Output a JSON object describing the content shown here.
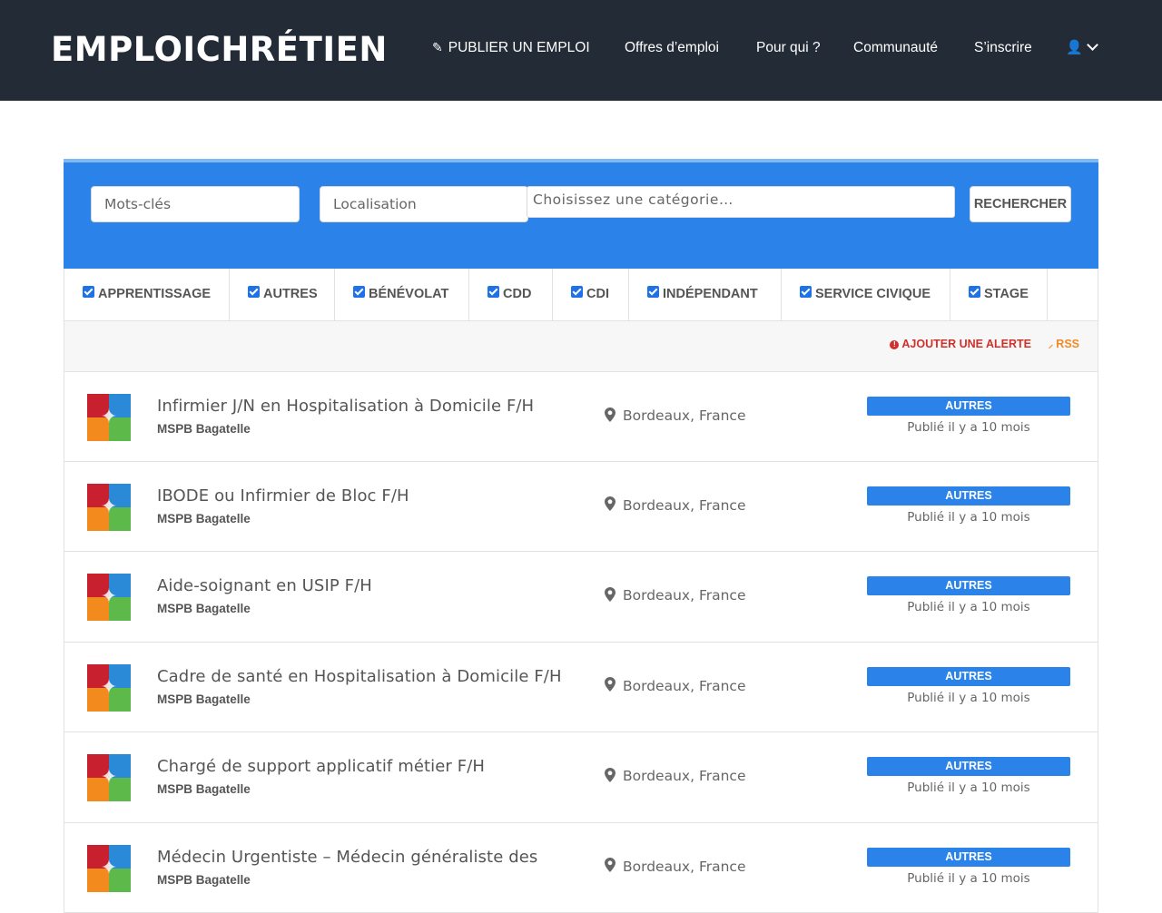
{
  "header": {
    "brand": "EMPLOICHRÉTIEN",
    "nav": {
      "publish": "PUBLIER UN EMPLOI",
      "offres": "Offres d’emploi",
      "pour_qui": "Pour qui ?",
      "communaute": "Communauté",
      "inscrire": "S’inscrire"
    }
  },
  "search": {
    "keywords_placeholder": "Mots-clés",
    "location_placeholder": "Localisation",
    "category_placeholder": "Choisissez une catégorie…",
    "button": "RECHERCHER"
  },
  "job_types": [
    "APPRENTISSAGE",
    "AUTRES",
    "BÉNÉVOLAT",
    "CDD",
    "CDI",
    "INDÉPENDANT",
    "SERVICE CIVIQUE",
    "STAGE"
  ],
  "actions": {
    "alert": "AJOUTER UNE ALERTE",
    "rss": "RSS"
  },
  "jobs": [
    {
      "title": "Infirmier J/N en Hospitalisation à Domicile F/H",
      "company": "MSPB Bagatelle",
      "location": "Bordeaux, France",
      "type": "AUTRES",
      "date": "Publié il y a 10 mois"
    },
    {
      "title": "IBODE ou Infirmier de Bloc F/H",
      "company": "MSPB Bagatelle",
      "location": "Bordeaux, France",
      "type": "AUTRES",
      "date": "Publié il y a 10 mois"
    },
    {
      "title": "Aide-soignant en USIP F/H",
      "company": "MSPB Bagatelle",
      "location": "Bordeaux, France",
      "type": "AUTRES",
      "date": "Publié il y a 10 mois"
    },
    {
      "title": "Cadre de santé en Hospitalisation à Domicile F/H",
      "company": "MSPB Bagatelle",
      "location": "Bordeaux, France",
      "type": "AUTRES",
      "date": "Publié il y a 10 mois"
    },
    {
      "title": "Chargé de support applicatif métier F/H",
      "company": "MSPB Bagatelle",
      "location": "Bordeaux, France",
      "type": "AUTRES",
      "date": "Publié il y a 10 mois"
    },
    {
      "title": "Médecin Urgentiste – Médecin généraliste des",
      "company": "MSPB Bagatelle",
      "location": "Bordeaux, France",
      "type": "AUTRES",
      "date": "Publié il y a 10 mois"
    }
  ],
  "colors": {
    "header_bg": "#232b36",
    "accent_blue": "#2b83ea",
    "alert_red": "#d0302b",
    "rss_orange": "#f08a24"
  },
  "icons": {
    "publish": "pencil-icon",
    "user": "user-icon",
    "dropdown": "chevron-down-icon",
    "alert": "exclamation-circle-icon",
    "rss": "rss-icon",
    "location": "map-pin-icon"
  }
}
